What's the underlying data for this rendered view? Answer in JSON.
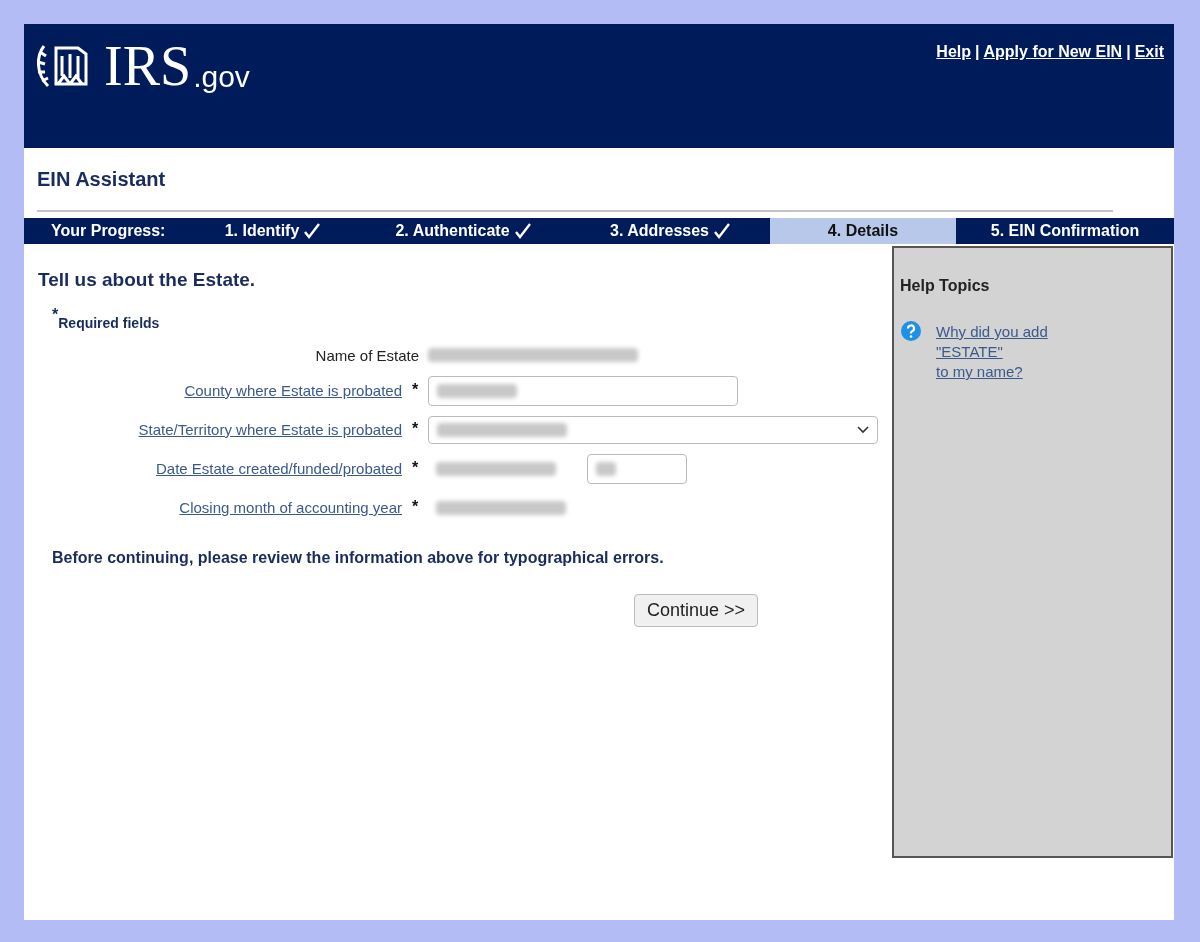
{
  "header": {
    "logo": {
      "name": "IRS",
      "suffix": ".gov"
    },
    "links": [
      "Help",
      "Apply for New EIN",
      "Exit"
    ],
    "separator": "|"
  },
  "app_title": "EIN Assistant",
  "progress": {
    "label": "Your Progress:",
    "steps": [
      {
        "label": "1. Identify",
        "done": true,
        "selected": false
      },
      {
        "label": "2. Authenticate",
        "done": true,
        "selected": false
      },
      {
        "label": "3. Addresses",
        "done": true,
        "selected": false
      },
      {
        "label": "4. Details",
        "done": false,
        "selected": true
      },
      {
        "label": "5. EIN Confirmation",
        "done": false,
        "selected": false
      }
    ]
  },
  "form": {
    "heading": "Tell us about the Estate.",
    "required_mark": "*",
    "required_note": "Required fields",
    "name_row": {
      "label": "Name of Estate"
    },
    "fields": [
      {
        "label": "County where Estate is probated",
        "kind": "text",
        "required": true
      },
      {
        "label": "State/Territory where Estate is probated",
        "kind": "select",
        "required": true
      },
      {
        "label": "Date Estate created/funded/probated",
        "kind": "date",
        "required": true
      },
      {
        "label": "Closing month of accounting year",
        "kind": "month",
        "required": true
      }
    ],
    "notice": "Before continuing, please review the information above for typographical errors.",
    "submit": "Continue >>"
  },
  "help": {
    "title": "Help Topics",
    "links": [
      {
        "lines": [
          "Why did you add",
          "\"ESTATE\"",
          "to my name?"
        ]
      }
    ]
  }
}
